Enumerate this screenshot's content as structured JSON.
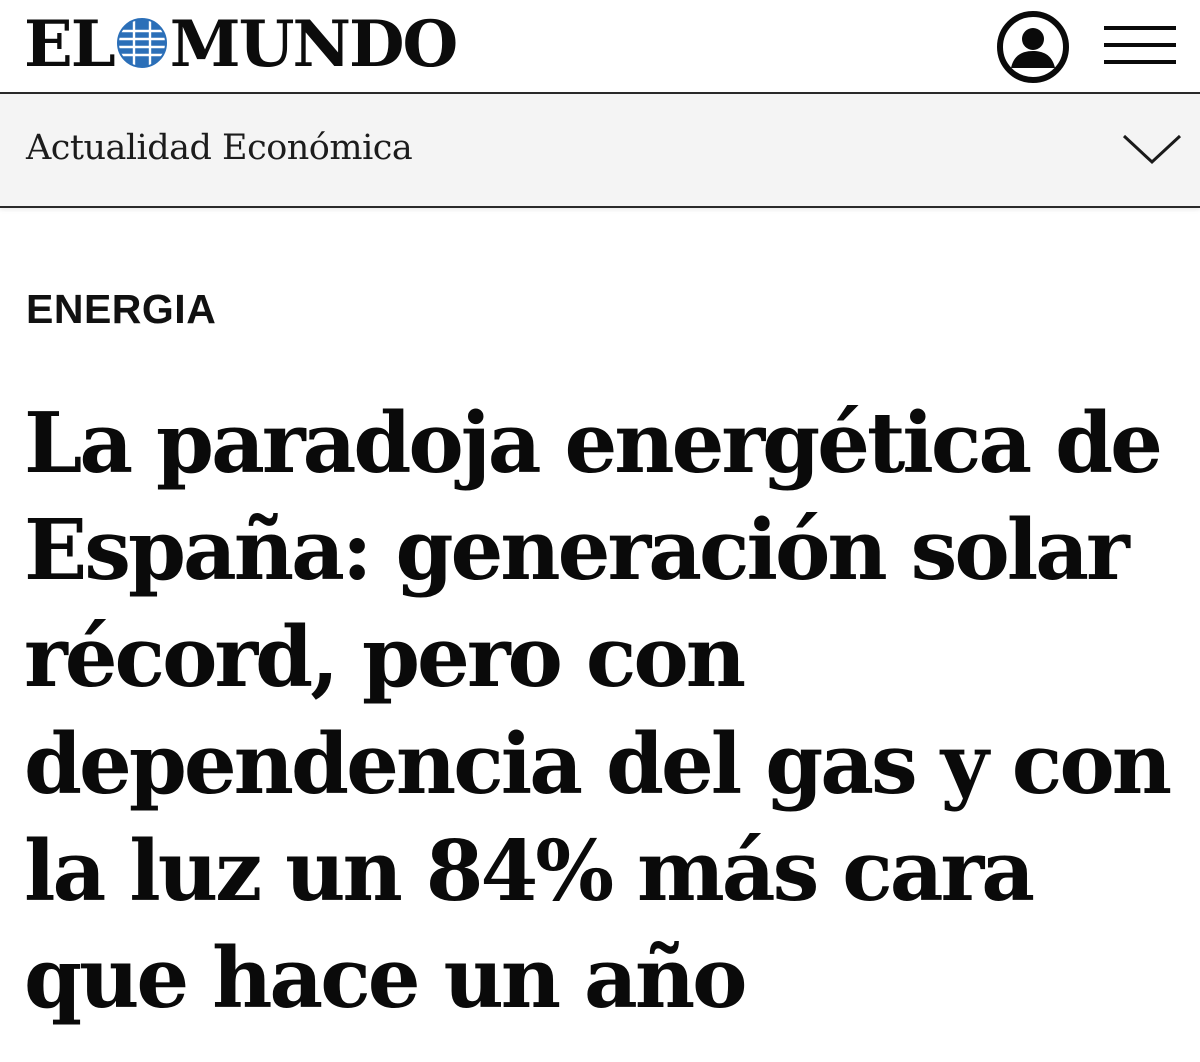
{
  "header": {
    "logo_left": "EL",
    "logo_right": "MUNDO",
    "user_icon": "user-account-icon",
    "menu_icon": "hamburger-menu-icon"
  },
  "section_bar": {
    "title": "Actualidad Económica",
    "chevron_icon": "chevron-down-icon"
  },
  "article": {
    "kicker": "ENERGIA",
    "headline_lines": [
      "La paradoja energética de",
      "España: generación solar",
      "récord, pero con",
      "dependencia del gas y con",
      "la luz un 84% más cara",
      "que hace un año"
    ]
  },
  "colors": {
    "text": "#0a0a0a",
    "brand_blue": "#2b6fb8",
    "section_bar_bg": "#f4f4f4",
    "divider": "#2a2a2a"
  }
}
